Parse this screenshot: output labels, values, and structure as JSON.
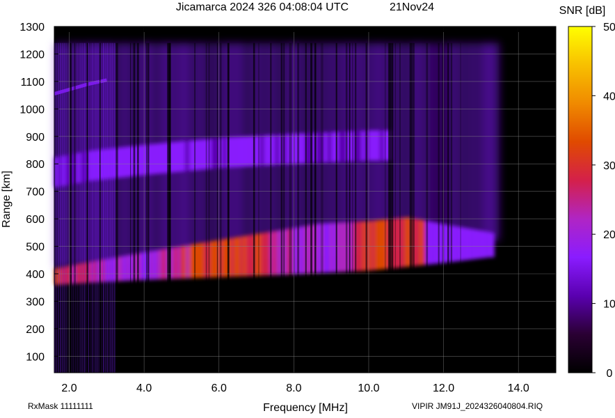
{
  "header": {
    "title": "Jicamarca 2024 326 04:08:04 UTC",
    "date": "21Nov24"
  },
  "footer": {
    "rxmask": "RxMask 11111111",
    "file": "VIPIR  JM91J_2024326040804.RIQ"
  },
  "colorbar": {
    "title": "SNR [dB]",
    "ticks": [
      0,
      10,
      20,
      30,
      40,
      50
    ],
    "stops": [
      "#000000",
      "#2a0033",
      "#5a00b0",
      "#8a1cff",
      "#b025c4",
      "#d4204a",
      "#e04a00",
      "#f08a00",
      "#f8c000",
      "#ffff00"
    ]
  },
  "chart_data": {
    "type": "heatmap",
    "title": "Jicamarca 2024 326 04:08:04 UTC",
    "xlabel": "Frequency [MHz]",
    "ylabel": "Range [km]",
    "xlim": [
      1.6,
      15.0
    ],
    "ylim": [
      40,
      1300
    ],
    "xticks": [
      2.0,
      4.0,
      6.0,
      8.0,
      10.0,
      12.0,
      14.0
    ],
    "yticks": [
      100,
      200,
      300,
      400,
      500,
      600,
      700,
      800,
      900,
      1000,
      1100,
      1200,
      1300
    ],
    "colorscale_label": "SNR [dB]",
    "zlim": [
      0,
      50
    ],
    "grid": true,
    "traces": [
      {
        "name": "",
        "points": [
          [
            1.6,
            360
          ],
          [
            2.5,
            368
          ],
          [
            4,
            378
          ],
          [
            6,
            388
          ],
          [
            8,
            398
          ],
          [
            10,
            412
          ],
          [
            12,
            440
          ],
          [
            13.2,
            460
          ]
        ]
      },
      {
        "name": "",
        "points": [
          [
            1.6,
            715
          ],
          [
            2.5,
            738
          ],
          [
            4,
            760
          ],
          [
            6,
            785
          ],
          [
            8,
            800
          ],
          [
            10,
            812
          ]
        ]
      },
      {
        "name": "",
        "points": [
          [
            1.6,
            1055
          ],
          [
            2.5,
            1090
          ],
          [
            3.0,
            1105
          ]
        ]
      }
    ]
  }
}
